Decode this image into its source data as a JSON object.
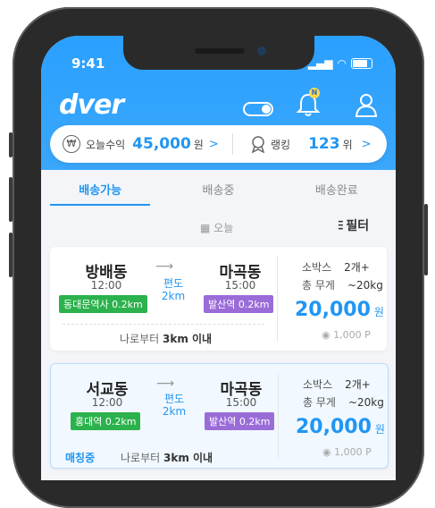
{
  "status": {
    "time": "9:41"
  },
  "header": {
    "logo": "dver"
  },
  "stats": {
    "earnings_label": "오늘수익",
    "earnings_value": "45,000",
    "earnings_unit": "원",
    "ranking_label": "랭킹",
    "ranking_value": "123",
    "ranking_unit": "위"
  },
  "tabs": [
    {
      "label": "배송가능"
    },
    {
      "label": "배송중"
    },
    {
      "label": "배송완료"
    }
  ],
  "filterbar": {
    "date_label": "오늘",
    "filter_label": "필터"
  },
  "cards": [
    {
      "from": "방배동",
      "from_time": "12:00",
      "from_station": "동대문역사 0.2km",
      "to": "마곡동",
      "to_time": "15:00",
      "to_station": "발산역 0.2km",
      "route_type": "편도",
      "route_dist": "2km",
      "near_label": "나로부터",
      "near_value": "3km 이내",
      "box_label": "소박스",
      "box_value": "2개+",
      "weight_label": "총 무게",
      "weight_value": "~20kg",
      "price": "20,000",
      "price_unit": "원",
      "points": "1,000 P"
    },
    {
      "from": "서교동",
      "from_time": "12:00",
      "from_station": "홍대역 0.2km",
      "to": "마곡동",
      "to_time": "15:00",
      "to_station": "발산역 0.2km",
      "route_type": "편도",
      "route_dist": "2km",
      "status": "매칭중",
      "near_label": "나로부터",
      "near_value": "3km 이내",
      "box_label": "소박스",
      "box_value": "2개+",
      "weight_label": "총 무게",
      "weight_value": "~20kg",
      "price": "20,000",
      "price_unit": "원",
      "points": "1,000 P"
    }
  ],
  "colors": {
    "accent": "#2196f3",
    "header_bg": "#2aa0ff",
    "tag_green": "#2bb24c",
    "tag_purple": "#9a6cd8"
  }
}
